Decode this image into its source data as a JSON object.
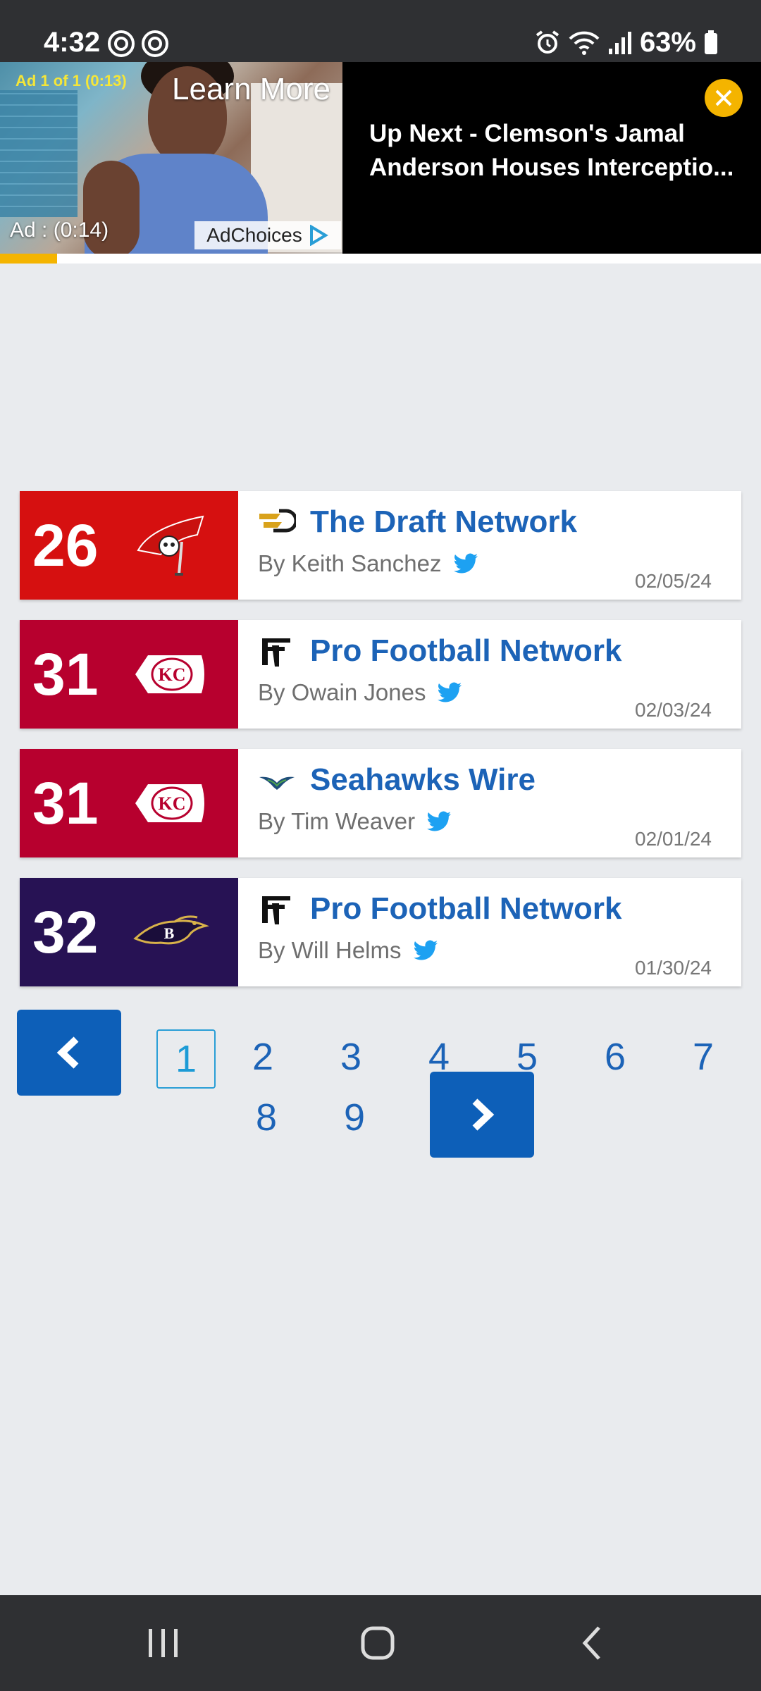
{
  "status_bar": {
    "time": "4:32",
    "battery": "63%"
  },
  "ad": {
    "counter": "Ad 1 of 1 (0:13)",
    "learn_more": "Learn More",
    "timer": "Ad : (0:14)",
    "adchoices": "AdChoices",
    "up_next": "Up Next - Clemson's Jamal Anderson Houses Interceptio...",
    "progress": 0.075,
    "accent_color": "#f4b400"
  },
  "picks": [
    {
      "pick": "26",
      "team_color": "#d61010",
      "team_logo": "buccaneers-logo-icon",
      "source": "The Draft Network",
      "source_icon": "draft-network-icon",
      "author": "By Keith Sanchez",
      "date": "02/05/24"
    },
    {
      "pick": "31",
      "team_color": "#b7002e",
      "team_logo": "chiefs-logo-icon",
      "source": "Pro Football Network",
      "source_icon": "pfn-icon",
      "author": "By Owain Jones",
      "date": "02/03/24"
    },
    {
      "pick": "31",
      "team_color": "#b7002e",
      "team_logo": "chiefs-logo-icon",
      "source": "Seahawks Wire",
      "source_icon": "seahawks-wire-icon",
      "author": "By Tim Weaver",
      "date": "02/01/24"
    },
    {
      "pick": "32",
      "team_color": "#271254",
      "team_logo": "ravens-logo-icon",
      "source": "Pro Football Network",
      "source_icon": "pfn-icon",
      "author": "By Will Helms",
      "date": "01/30/24"
    }
  ],
  "pagination": {
    "pages": [
      "1",
      "2",
      "3",
      "4",
      "5",
      "6",
      "7",
      "8",
      "9"
    ],
    "current": "1",
    "button_color": "#0d5fb8"
  }
}
